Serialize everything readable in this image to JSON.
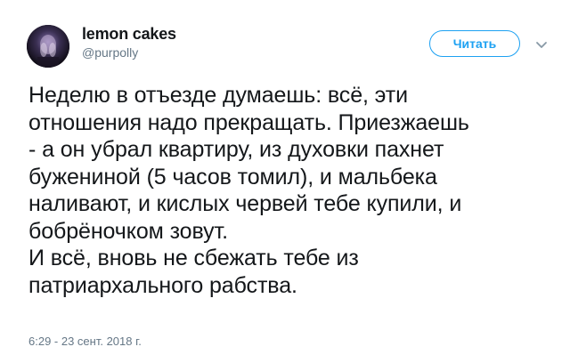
{
  "author": {
    "display_name": "lemon cakes",
    "handle": "@purpolly"
  },
  "follow_button": {
    "label": "Читать"
  },
  "tweet": {
    "text": "Неделю в отъезде думаешь: всё, эти\nотношения надо прекращать. Приезжаешь\n- а он убрал квартиру, из духовки пахнет\nбужениной (5 часов томил), и мальбека\nналивают, и кислых червей тебе купили, и\nбобрёночком зовут.\nИ всё, вновь не сбежать тебе из\nпатриархального рабства.",
    "timestamp": "6:29 - 23 сент. 2018 г."
  },
  "colors": {
    "accent": "#1da1f2",
    "text": "#14171a",
    "secondary": "#657786"
  },
  "icons": {
    "avatar": "avatar-image",
    "caret": "chevron-down-icon"
  }
}
